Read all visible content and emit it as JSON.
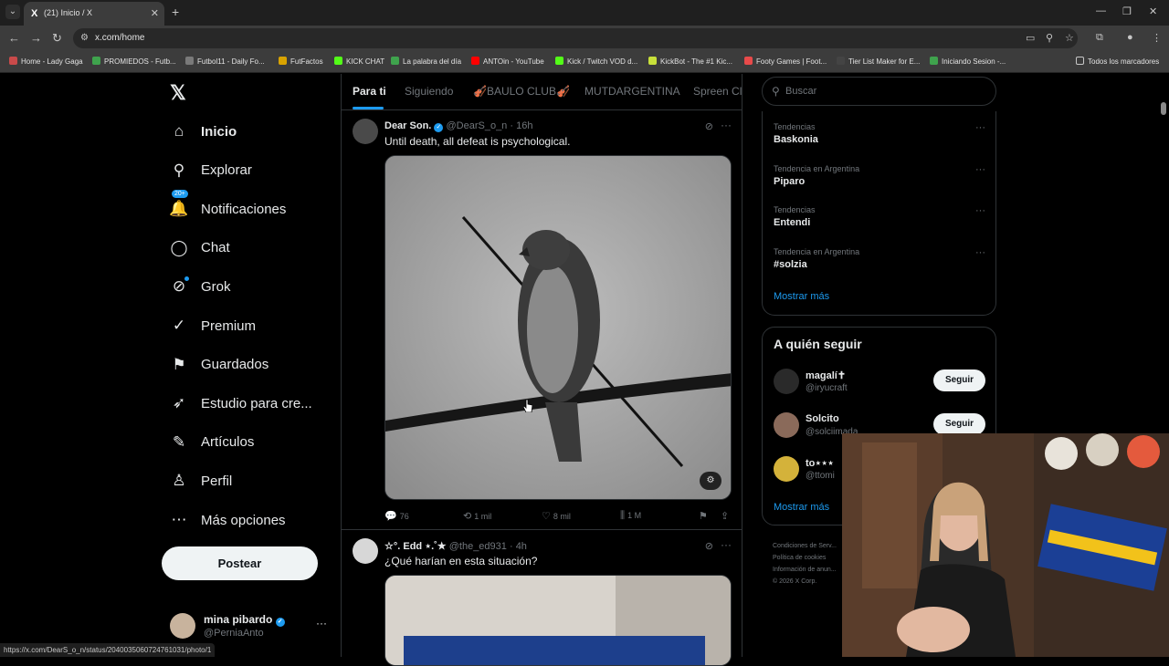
{
  "browser": {
    "tab_title": "(21) Inicio / X",
    "url": "x.com/home",
    "status_url": "https://x.com/DearS_o_n/status/2040035060724761031/photo/1",
    "bookmarks": [
      {
        "label": "Home - Lady Gaga",
        "color": "#c94a4a"
      },
      {
        "label": "PROMIEDOS - Futb...",
        "color": "#3fa34d"
      },
      {
        "label": "Futbol11 - Daily Fo...",
        "color": "#7a7a7a"
      },
      {
        "label": "FutFactos",
        "color": "#d9a300"
      },
      {
        "label": "KICK CHAT",
        "color": "#53fc18"
      },
      {
        "label": "La palabra del día",
        "color": "#3fa34d"
      },
      {
        "label": "ANTOin - YouTube",
        "color": "#ff0000"
      },
      {
        "label": "Kick / Twitch VOD d...",
        "color": "#53fc18"
      },
      {
        "label": "KickBot - The #1 Kic...",
        "color": "#c8e03a"
      },
      {
        "label": "Footy Games | Foot...",
        "color": "#e84a4a"
      },
      {
        "label": "Tier List Maker for E...",
        "color": "#444444"
      },
      {
        "label": "Iniciando Sesion -...",
        "color": "#3fa34d"
      }
    ],
    "all_bookmarks": "Todos los marcadores"
  },
  "sidebar": {
    "items": [
      {
        "label": "Inicio",
        "icon": "home-icon",
        "glyph": "⌂"
      },
      {
        "label": "Explorar",
        "icon": "search-icon",
        "glyph": "⚲"
      },
      {
        "label": "Notificaciones",
        "icon": "bell-icon",
        "glyph": "🔔"
      },
      {
        "label": "Chat",
        "icon": "chat-icon",
        "glyph": "◯"
      },
      {
        "label": "Grok",
        "icon": "grok-icon",
        "glyph": "⊘"
      },
      {
        "label": "Premium",
        "icon": "premium-icon",
        "glyph": "✓"
      },
      {
        "label": "Guardados",
        "icon": "bookmark-icon",
        "glyph": "⚑"
      },
      {
        "label": "Estudio para cre...",
        "icon": "rocket-icon",
        "glyph": "➶"
      },
      {
        "label": "Artículos",
        "icon": "articles-icon",
        "glyph": "✎"
      },
      {
        "label": "Perfil",
        "icon": "profile-icon",
        "glyph": "♙"
      },
      {
        "label": "Más opciones",
        "icon": "more-icon",
        "glyph": "⋯"
      }
    ],
    "notif_badge": "20+",
    "post_button": "Postear",
    "user": {
      "name": "mina pibardo",
      "handle": "@PerniaAnto"
    }
  },
  "feed": {
    "tabs": [
      "Para ti",
      "Siguiendo",
      "🎻BAULO CLUB🎻",
      "MUTDARGENTINA",
      "Spreen Cl..."
    ],
    "tweets": [
      {
        "name": "Dear Son.",
        "handle": "@DearS_o_n",
        "time": "· 16h",
        "text": "Until death, all defeat is psychological.",
        "replies": "76",
        "reposts": "1 mil",
        "likes": "8 mil",
        "views": "1 M"
      },
      {
        "name": "☆°. Edd ⋆.˚★",
        "handle": "@the_ed931",
        "time": "· 4h",
        "text": "¿Qué harían en esta situación?"
      }
    ]
  },
  "right": {
    "search_placeholder": "Buscar",
    "trends": [
      {
        "context": "Tendencias",
        "topic": "Baskonia"
      },
      {
        "context": "Tendencia en Argentina",
        "topic": "Piparo"
      },
      {
        "context": "Tendencias",
        "topic": "Entendi"
      },
      {
        "context": "Tendencia en Argentina",
        "topic": "#solzia"
      }
    ],
    "show_more": "Mostrar más",
    "who_title": "A quién seguir",
    "who": [
      {
        "name": "magalí✝",
        "handle": "@iryucraft"
      },
      {
        "name": "Solcito",
        "handle": "@solciimada"
      },
      {
        "name": "to⋆⋆⋆",
        "handle": "@ttomi"
      }
    ],
    "follow_label": "Seguir",
    "footer": [
      "Condiciones de Serv...",
      "Política de cookies",
      "Información de anun...",
      "© 2026 X Corp."
    ]
  }
}
